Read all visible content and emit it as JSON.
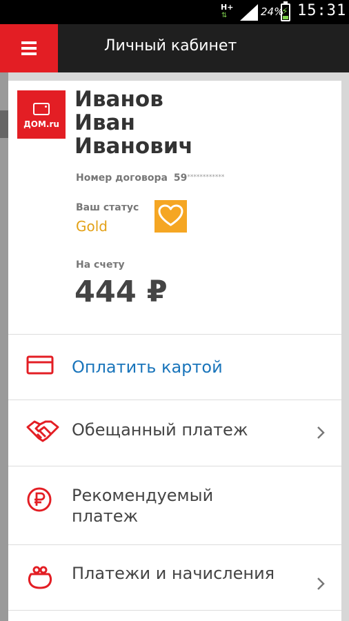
{
  "status_bar": {
    "network": "H+",
    "battery_percent": "24%",
    "time": "15:31"
  },
  "app_bar": {
    "title": "Личный кабинет",
    "menu_icon": "hamburger-menu-icon"
  },
  "profile": {
    "logo_text": "ДОМ.ru",
    "last_name": "Иванов",
    "first_name": "Иван",
    "patronymic": "Иванович",
    "contract_label": "Номер договора",
    "contract_number": "59",
    "contract_mask": "************",
    "status_label": "Ваш статус",
    "status_value": "Gold",
    "status_icon": "heart-icon",
    "balance_label": "На счету",
    "balance_value": "444 ₽"
  },
  "menu": [
    {
      "label": "Оплатить картой",
      "icon": "credit-card-icon",
      "has_chevron": false
    },
    {
      "label": "Обещанный платеж",
      "icon": "handshake-icon",
      "has_chevron": true
    },
    {
      "label_line1": "Рекомендуемый",
      "label_line2": "платеж",
      "icon": "ruble-circle-icon",
      "has_chevron": false
    },
    {
      "label": "Платежи и начисления",
      "icon": "purse-icon",
      "has_chevron": true
    }
  ],
  "colors": {
    "brand_red": "#e31e24",
    "app_bar": "#1f1f1f",
    "gold": "#e3a117",
    "badge": "#f5a623",
    "link_blue": "#1a75bb"
  }
}
